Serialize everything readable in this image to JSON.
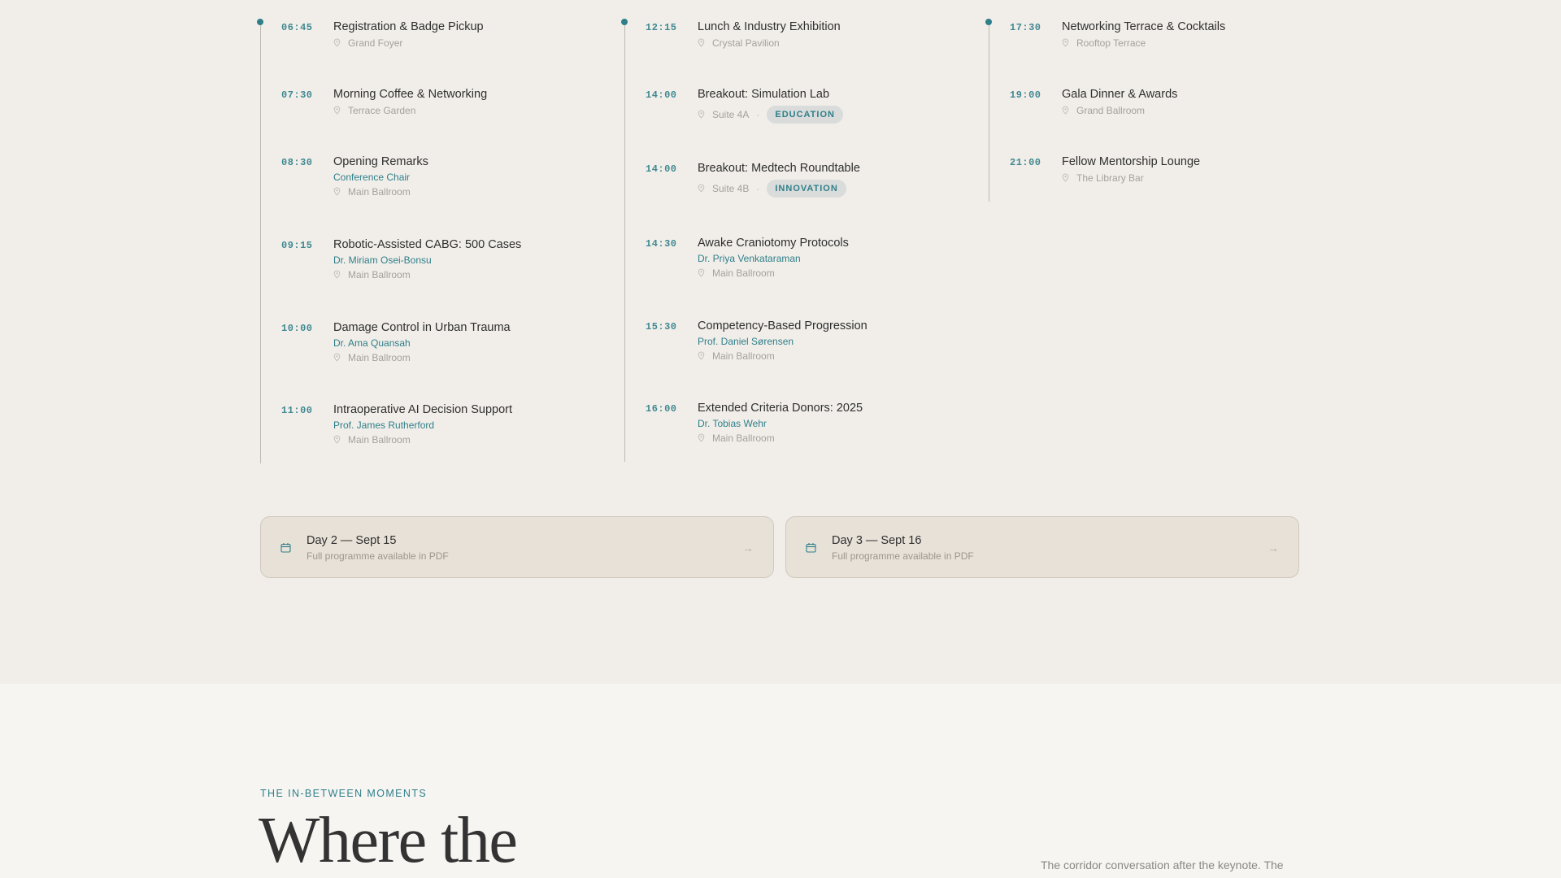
{
  "schedule": {
    "columns": [
      {
        "events": [
          {
            "time": "06:45",
            "title": "Registration & Badge Pickup",
            "location": "Grand Foyer"
          },
          {
            "time": "07:30",
            "title": "Morning Coffee & Networking",
            "location": "Terrace Garden"
          },
          {
            "time": "08:30",
            "title": "Opening Remarks",
            "speaker": "Conference Chair",
            "location": "Main Ballroom"
          },
          {
            "time": "09:15",
            "title": "Robotic-Assisted CABG: 500 Cases",
            "speaker": "Dr. Miriam Osei-Bonsu",
            "location": "Main Ballroom"
          },
          {
            "time": "10:00",
            "title": "Damage Control in Urban Trauma",
            "speaker": "Dr. Ama Quansah",
            "location": "Main Ballroom"
          },
          {
            "time": "11:00",
            "title": "Intraoperative AI Decision Support",
            "speaker": "Prof. James Rutherford",
            "location": "Main Ballroom"
          }
        ]
      },
      {
        "events": [
          {
            "time": "12:15",
            "title": "Lunch & Industry Exhibition",
            "location": "Crystal Pavilion"
          },
          {
            "time": "14:00",
            "title": "Breakout: Simulation Lab",
            "location": "Suite 4A",
            "tag": "EDUCATION"
          },
          {
            "time": "14:00",
            "title": "Breakout: Medtech Roundtable",
            "location": "Suite 4B",
            "tag": "INNOVATION"
          },
          {
            "time": "14:30",
            "title": "Awake Craniotomy Protocols",
            "speaker": "Dr. Priya Venkataraman",
            "location": "Main Ballroom"
          },
          {
            "time": "15:30",
            "title": "Competency-Based Progression",
            "speaker": "Prof. Daniel Sørensen",
            "location": "Main Ballroom"
          },
          {
            "time": "16:00",
            "title": "Extended Criteria Donors: 2025",
            "speaker": "Dr. Tobias Wehr",
            "location": "Main Ballroom"
          }
        ]
      },
      {
        "events": [
          {
            "time": "17:30",
            "title": "Networking Terrace & Cocktails",
            "location": "Rooftop Terrace"
          },
          {
            "time": "19:00",
            "title": "Gala Dinner & Awards",
            "location": "Grand Ballroom"
          },
          {
            "time": "21:00",
            "title": "Fellow Mentorship Lounge",
            "location": "The Library Bar"
          }
        ]
      }
    ]
  },
  "day_cards": [
    {
      "title": "Day 2 — Sept 15",
      "subtitle": "Full programme available in PDF",
      "arrow": "→"
    },
    {
      "title": "Day 3 — Sept 16",
      "subtitle": "Full programme available in PDF",
      "arrow": "→"
    }
  ],
  "section": {
    "eyebrow": "THE IN-BETWEEN MOMENTS",
    "headline": "Where the",
    "lede": "The corridor conversation after the keynote. The"
  },
  "colors": {
    "accent": "#2f7f8a",
    "page_background": "#f1eee9",
    "card_background": "#e8e1d8"
  },
  "icons": {
    "location": "map-pin-icon",
    "day_card": "calendar-icon",
    "day_card_arrow": "arrow-right-icon"
  }
}
